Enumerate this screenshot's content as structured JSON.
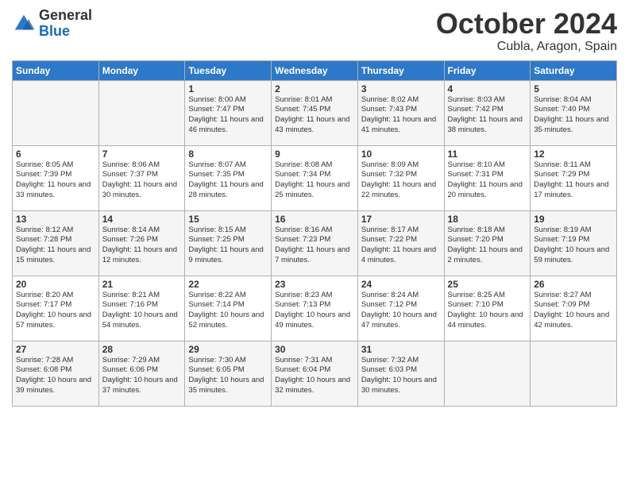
{
  "header": {
    "logo_general": "General",
    "logo_blue": "Blue",
    "month_title": "October 2024",
    "location": "Cubla, Aragon, Spain"
  },
  "days_of_week": [
    "Sunday",
    "Monday",
    "Tuesday",
    "Wednesday",
    "Thursday",
    "Friday",
    "Saturday"
  ],
  "weeks": [
    [
      {
        "day": "",
        "info": ""
      },
      {
        "day": "",
        "info": ""
      },
      {
        "day": "1",
        "info": "Sunrise: 8:00 AM\nSunset: 7:47 PM\nDaylight: 11 hours and 46 minutes."
      },
      {
        "day": "2",
        "info": "Sunrise: 8:01 AM\nSunset: 7:45 PM\nDaylight: 11 hours and 43 minutes."
      },
      {
        "day": "3",
        "info": "Sunrise: 8:02 AM\nSunset: 7:43 PM\nDaylight: 11 hours and 41 minutes."
      },
      {
        "day": "4",
        "info": "Sunrise: 8:03 AM\nSunset: 7:42 PM\nDaylight: 11 hours and 38 minutes."
      },
      {
        "day": "5",
        "info": "Sunrise: 8:04 AM\nSunset: 7:40 PM\nDaylight: 11 hours and 35 minutes."
      }
    ],
    [
      {
        "day": "6",
        "info": "Sunrise: 8:05 AM\nSunset: 7:39 PM\nDaylight: 11 hours and 33 minutes."
      },
      {
        "day": "7",
        "info": "Sunrise: 8:06 AM\nSunset: 7:37 PM\nDaylight: 11 hours and 30 minutes."
      },
      {
        "day": "8",
        "info": "Sunrise: 8:07 AM\nSunset: 7:35 PM\nDaylight: 11 hours and 28 minutes."
      },
      {
        "day": "9",
        "info": "Sunrise: 8:08 AM\nSunset: 7:34 PM\nDaylight: 11 hours and 25 minutes."
      },
      {
        "day": "10",
        "info": "Sunrise: 8:09 AM\nSunset: 7:32 PM\nDaylight: 11 hours and 22 minutes."
      },
      {
        "day": "11",
        "info": "Sunrise: 8:10 AM\nSunset: 7:31 PM\nDaylight: 11 hours and 20 minutes."
      },
      {
        "day": "12",
        "info": "Sunrise: 8:11 AM\nSunset: 7:29 PM\nDaylight: 11 hours and 17 minutes."
      }
    ],
    [
      {
        "day": "13",
        "info": "Sunrise: 8:12 AM\nSunset: 7:28 PM\nDaylight: 11 hours and 15 minutes."
      },
      {
        "day": "14",
        "info": "Sunrise: 8:14 AM\nSunset: 7:26 PM\nDaylight: 11 hours and 12 minutes."
      },
      {
        "day": "15",
        "info": "Sunrise: 8:15 AM\nSunset: 7:25 PM\nDaylight: 11 hours and 9 minutes."
      },
      {
        "day": "16",
        "info": "Sunrise: 8:16 AM\nSunset: 7:23 PM\nDaylight: 11 hours and 7 minutes."
      },
      {
        "day": "17",
        "info": "Sunrise: 8:17 AM\nSunset: 7:22 PM\nDaylight: 11 hours and 4 minutes."
      },
      {
        "day": "18",
        "info": "Sunrise: 8:18 AM\nSunset: 7:20 PM\nDaylight: 11 hours and 2 minutes."
      },
      {
        "day": "19",
        "info": "Sunrise: 8:19 AM\nSunset: 7:19 PM\nDaylight: 10 hours and 59 minutes."
      }
    ],
    [
      {
        "day": "20",
        "info": "Sunrise: 8:20 AM\nSunset: 7:17 PM\nDaylight: 10 hours and 57 minutes."
      },
      {
        "day": "21",
        "info": "Sunrise: 8:21 AM\nSunset: 7:16 PM\nDaylight: 10 hours and 54 minutes."
      },
      {
        "day": "22",
        "info": "Sunrise: 8:22 AM\nSunset: 7:14 PM\nDaylight: 10 hours and 52 minutes."
      },
      {
        "day": "23",
        "info": "Sunrise: 8:23 AM\nSunset: 7:13 PM\nDaylight: 10 hours and 49 minutes."
      },
      {
        "day": "24",
        "info": "Sunrise: 8:24 AM\nSunset: 7:12 PM\nDaylight: 10 hours and 47 minutes."
      },
      {
        "day": "25",
        "info": "Sunrise: 8:25 AM\nSunset: 7:10 PM\nDaylight: 10 hours and 44 minutes."
      },
      {
        "day": "26",
        "info": "Sunrise: 8:27 AM\nSunset: 7:09 PM\nDaylight: 10 hours and 42 minutes."
      }
    ],
    [
      {
        "day": "27",
        "info": "Sunrise: 7:28 AM\nSunset: 6:08 PM\nDaylight: 10 hours and 39 minutes."
      },
      {
        "day": "28",
        "info": "Sunrise: 7:29 AM\nSunset: 6:06 PM\nDaylight: 10 hours and 37 minutes."
      },
      {
        "day": "29",
        "info": "Sunrise: 7:30 AM\nSunset: 6:05 PM\nDaylight: 10 hours and 35 minutes."
      },
      {
        "day": "30",
        "info": "Sunrise: 7:31 AM\nSunset: 6:04 PM\nDaylight: 10 hours and 32 minutes."
      },
      {
        "day": "31",
        "info": "Sunrise: 7:32 AM\nSunset: 6:03 PM\nDaylight: 10 hours and 30 minutes."
      },
      {
        "day": "",
        "info": ""
      },
      {
        "day": "",
        "info": ""
      }
    ]
  ]
}
